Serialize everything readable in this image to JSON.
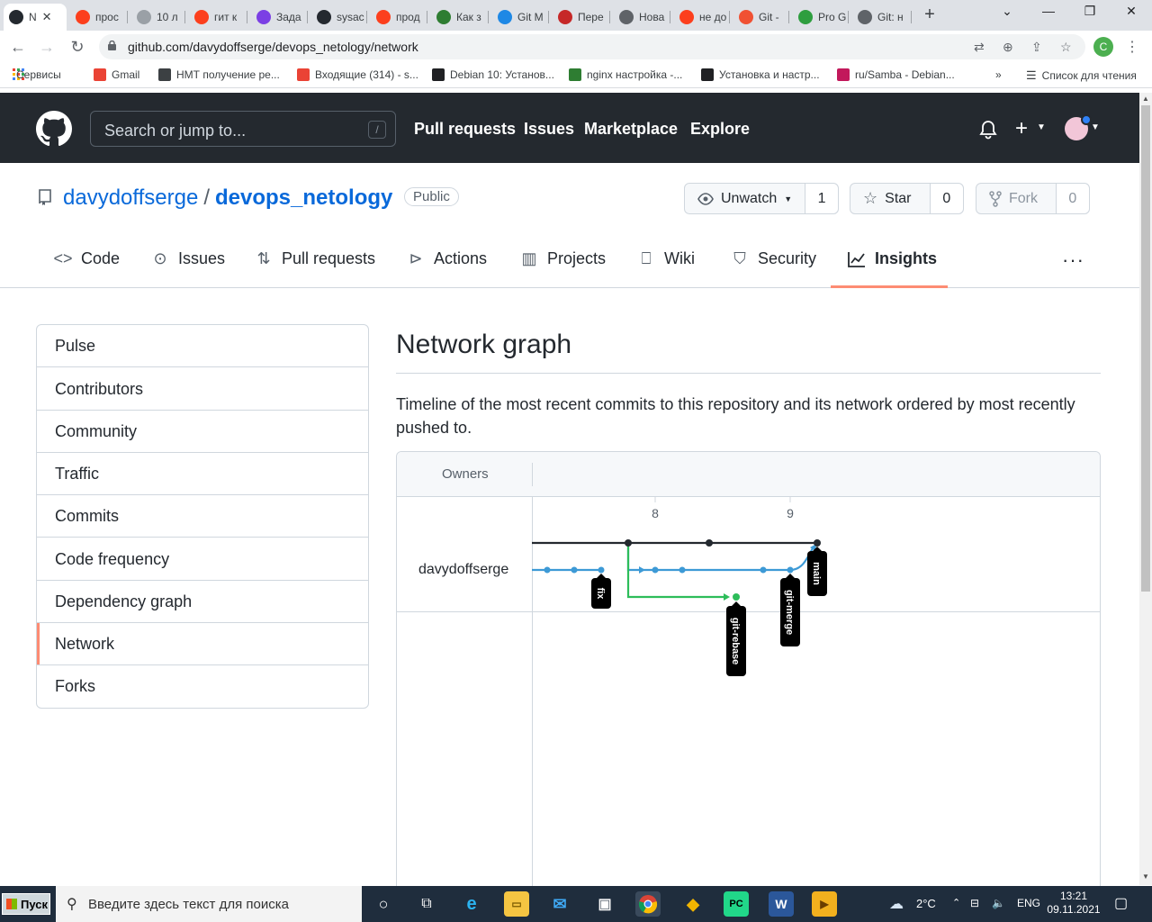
{
  "browser": {
    "tabs": [
      {
        "title": "N",
        "favicon": "github-icon",
        "color": "#24292f",
        "active": true
      },
      {
        "title": "прос",
        "favicon": "yandex-icon",
        "color": "#fc3f1d"
      },
      {
        "title": "10 л",
        "favicon": "page-icon",
        "color": "#9aa0a6"
      },
      {
        "title": "гит к",
        "favicon": "yandex-icon",
        "color": "#fc3f1d"
      },
      {
        "title": "Зада",
        "favicon": "dots-icon",
        "color": "#7b3fe4"
      },
      {
        "title": "sysac",
        "favicon": "github-icon",
        "color": "#24292f"
      },
      {
        "title": "прод",
        "favicon": "yandex-icon",
        "color": "#fc3f1d"
      },
      {
        "title": "Как з",
        "favicon": "m-icon",
        "color": "#2e7d32"
      },
      {
        "title": "Git M",
        "favicon": "diamond-icon",
        "color": "#1e88e5"
      },
      {
        "title": "Пере",
        "favicon": "circle-a-icon",
        "color": "#c62828"
      },
      {
        "title": "Нова",
        "favicon": "chrome-icon",
        "color": "#5f6368"
      },
      {
        "title": "не до",
        "favicon": "yandex-icon",
        "color": "#fc3f1d"
      },
      {
        "title": "Git -",
        "favicon": "git-icon",
        "color": "#f05133"
      },
      {
        "title": "Pro G",
        "favicon": "progit-icon",
        "color": "#2e9e3f"
      },
      {
        "title": "Git: н",
        "favicon": "chrome-icon",
        "color": "#5f6368"
      }
    ],
    "new_tab_label": "+",
    "url": "github.com/davydoffserge/devops_netology/network",
    "profile_initial": "C",
    "bookmarks": [
      {
        "label": "Сервисы",
        "color": "#ea4335"
      },
      {
        "label": "Gmail",
        "color": "#ea4335"
      },
      {
        "label": "НМТ получение ре...",
        "color": "#3c4043"
      },
      {
        "label": "Входящие (314) - s...",
        "color": "#ea4335"
      },
      {
        "label": "Debian 10: Установ...",
        "color": "#202124"
      },
      {
        "label": "nginx настройка -...",
        "color": "#2e7d32"
      },
      {
        "label": "Установка и настр...",
        "color": "#202124"
      },
      {
        "label": "ru/Samba - Debian...",
        "color": "#c2185b"
      }
    ],
    "bookmarks_more": "»",
    "reading_list": "Список для чтения"
  },
  "github": {
    "search_placeholder": "Search or jump to...",
    "search_shortcut": "/",
    "nav": [
      "Pull requests",
      "Issues",
      "Marketplace",
      "Explore"
    ],
    "plus_label": "+"
  },
  "repo": {
    "owner": "davydoffserge",
    "separator": "/",
    "name": "devops_netology",
    "visibility": "Public",
    "unwatch_label": "Unwatch",
    "watch_count": "1",
    "star_label": "Star",
    "star_count": "0",
    "fork_label": "Fork",
    "fork_count": "0",
    "tabs": [
      {
        "label": "Code",
        "icon": "code-icon"
      },
      {
        "label": "Issues",
        "icon": "issue-icon"
      },
      {
        "label": "Pull requests",
        "icon": "pull-request-icon"
      },
      {
        "label": "Actions",
        "icon": "play-icon"
      },
      {
        "label": "Projects",
        "icon": "project-icon"
      },
      {
        "label": "Wiki",
        "icon": "book-icon"
      },
      {
        "label": "Security",
        "icon": "shield-icon"
      },
      {
        "label": "Insights",
        "icon": "graph-icon",
        "selected": true
      }
    ],
    "more_label": "···"
  },
  "sidebar": {
    "items": [
      {
        "label": "Pulse"
      },
      {
        "label": "Contributors"
      },
      {
        "label": "Community"
      },
      {
        "label": "Traffic"
      },
      {
        "label": "Commits"
      },
      {
        "label": "Code frequency"
      },
      {
        "label": "Dependency graph"
      },
      {
        "label": "Network",
        "current": true
      },
      {
        "label": "Forks"
      }
    ]
  },
  "main": {
    "title": "Network graph",
    "description": "Timeline of the most recent commits to this repository and its network ordered by most recently pushed to.",
    "owners_header": "Owners",
    "owner": "davydoffserge",
    "dates": [
      "8",
      "9"
    ],
    "branches": [
      "main",
      "fix",
      "git-merge",
      "git-rebase"
    ],
    "colors": {
      "main": "#24292f",
      "fix": "#3d9ad6",
      "git-merge": "#3d9ad6",
      "git-rebase": "#2dbd5a",
      "accent": "#fd8c73",
      "link": "#0969da"
    }
  },
  "taskbar": {
    "start_label": "Пуск",
    "search_placeholder": "Введите здесь текст для поиска",
    "weather": "2°C",
    "language": "ENG",
    "time": "13:21",
    "date": "09.11.2021"
  }
}
